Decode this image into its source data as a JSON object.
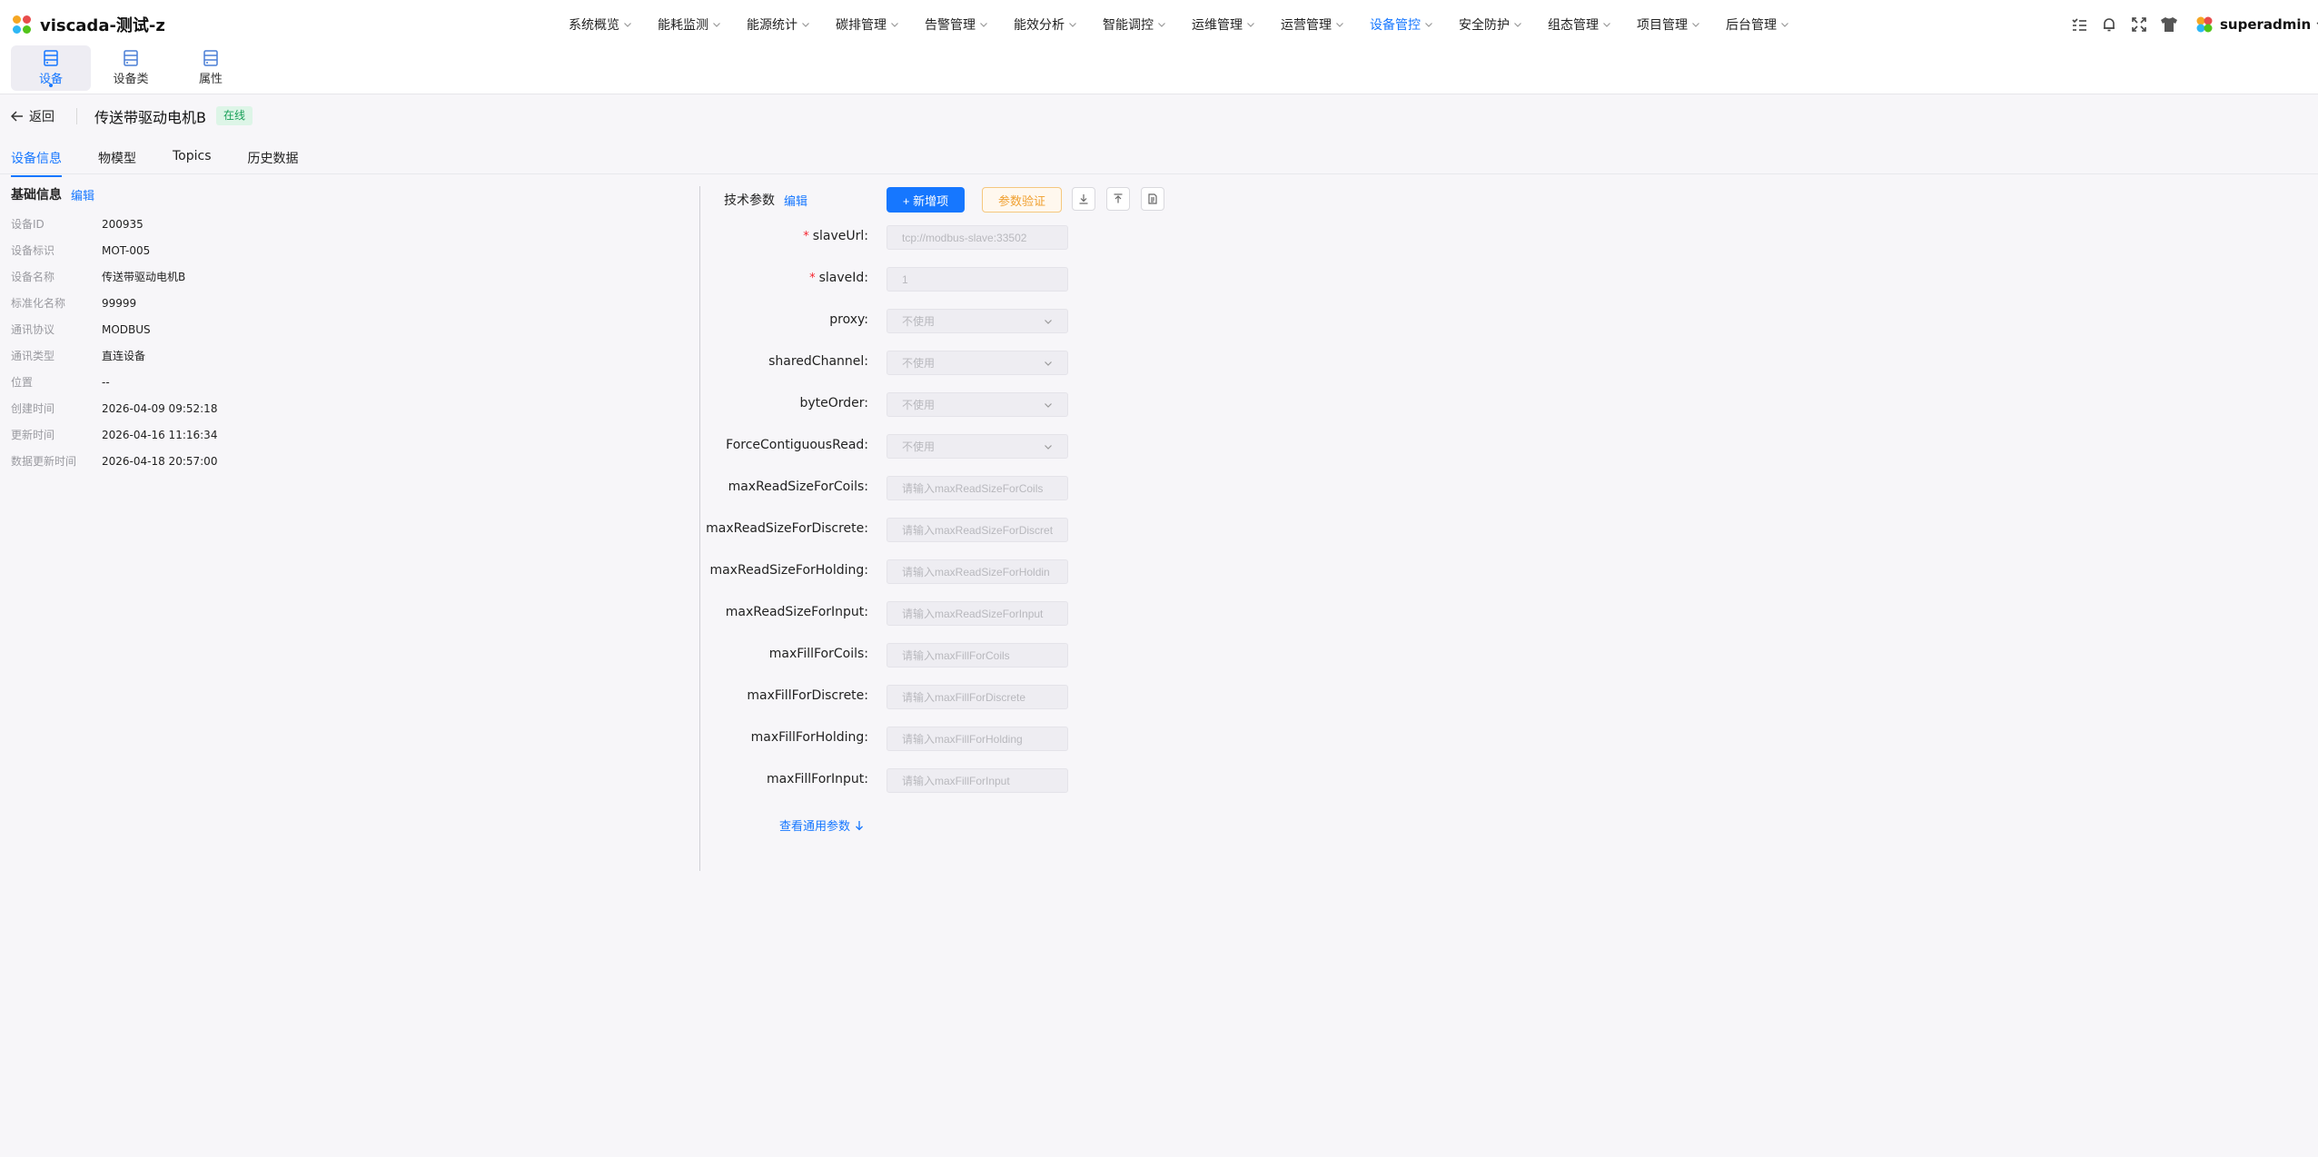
{
  "app": {
    "title": "viscada-测试-z",
    "logo_colors": [
      "#f5a623",
      "#e84c4c",
      "#2db7f5",
      "#52c41a"
    ]
  },
  "nav": {
    "items": [
      {
        "label": "系统概览"
      },
      {
        "label": "能耗监测"
      },
      {
        "label": "能源统计"
      },
      {
        "label": "碳排管理"
      },
      {
        "label": "告警管理"
      },
      {
        "label": "能效分析"
      },
      {
        "label": "智能调控"
      },
      {
        "label": "运维管理"
      },
      {
        "label": "运营管理"
      },
      {
        "label": "设备管控",
        "active": true
      },
      {
        "label": "安全防护"
      },
      {
        "label": "组态管理"
      },
      {
        "label": "项目管理"
      },
      {
        "label": "后台管理"
      }
    ]
  },
  "toolbar_icons": [
    "list-icon",
    "bell-icon",
    "fullscreen-icon",
    "theme-shirt-icon"
  ],
  "user": {
    "name": "superadmin"
  },
  "subnav": [
    {
      "label": "设备",
      "icon": "device-icon",
      "active": true
    },
    {
      "label": "设备类",
      "icon": "device-class-icon"
    },
    {
      "label": "属性",
      "icon": "property-icon"
    }
  ],
  "header": {
    "back_label": "返回",
    "device_title": "传送带驱动电机B",
    "status": "在线",
    "status_color": "#18a058"
  },
  "tabs": [
    {
      "label": "设备信息",
      "active": true
    },
    {
      "label": "物模型"
    },
    {
      "label": "Topics"
    },
    {
      "label": "历史数据"
    }
  ],
  "basic": {
    "title": "基础信息",
    "edit": "编辑",
    "rows": [
      {
        "label": "设备ID",
        "value": "200935"
      },
      {
        "label": "设备标识",
        "value": "MOT-005"
      },
      {
        "label": "设备名称",
        "value": "传送带驱动电机B"
      },
      {
        "label": "标准化名称",
        "value": "99999"
      },
      {
        "label": "通讯协议",
        "value": "MODBUS"
      },
      {
        "label": "通讯类型",
        "value": "直连设备"
      },
      {
        "label": "位置",
        "value": "--"
      },
      {
        "label": "创建时间",
        "value": "2026-04-09 09:52:18"
      },
      {
        "label": "更新时间",
        "value": "2026-04-16 11:16:34"
      },
      {
        "label": "数据更新时间",
        "value": "2026-04-18 20:57:00"
      }
    ]
  },
  "tech": {
    "title": "技术参数",
    "edit": "编辑",
    "add_button": "+ 新增项",
    "verify_button": "参数验证",
    "icon_buttons": [
      "download-icon",
      "upload-icon",
      "document-icon"
    ],
    "fields": [
      {
        "label": "slaveUrl:",
        "required": true,
        "type": "input",
        "placeholder": "tcp://modbus-slave:33502"
      },
      {
        "label": "slaveId:",
        "required": true,
        "type": "input",
        "placeholder": "1"
      },
      {
        "label": "proxy:",
        "type": "select",
        "placeholder": "不使用"
      },
      {
        "label": "sharedChannel:",
        "type": "select",
        "placeholder": "不使用"
      },
      {
        "label": "byteOrder:",
        "type": "select",
        "placeholder": "不使用"
      },
      {
        "label": "ForceContiguousRead:",
        "type": "select",
        "placeholder": "不使用"
      },
      {
        "label": "maxReadSizeForCoils:",
        "type": "input",
        "placeholder": "请输入maxReadSizeForCoils"
      },
      {
        "label": "maxReadSizeForDiscrete:",
        "type": "input",
        "placeholder": "请输入maxReadSizeForDiscret"
      },
      {
        "label": "maxReadSizeForHolding:",
        "type": "input",
        "placeholder": "请输入maxReadSizeForHoldin"
      },
      {
        "label": "maxReadSizeForInput:",
        "type": "input",
        "placeholder": "请输入maxReadSizeForInput"
      },
      {
        "label": "maxFillForCoils:",
        "type": "input",
        "placeholder": "请输入maxFillForCoils"
      },
      {
        "label": "maxFillForDiscrete:",
        "type": "input",
        "placeholder": "请输入maxFillForDiscrete"
      },
      {
        "label": "maxFillForHolding:",
        "type": "input",
        "placeholder": "请输入maxFillForHolding"
      },
      {
        "label": "maxFillForInput:",
        "type": "input",
        "placeholder": "请输入maxFillForInput"
      }
    ],
    "more_link": "查看通用参数"
  },
  "colors": {
    "accent": "#1677ff",
    "warning": "#f0a030",
    "required": "#f5222d"
  }
}
